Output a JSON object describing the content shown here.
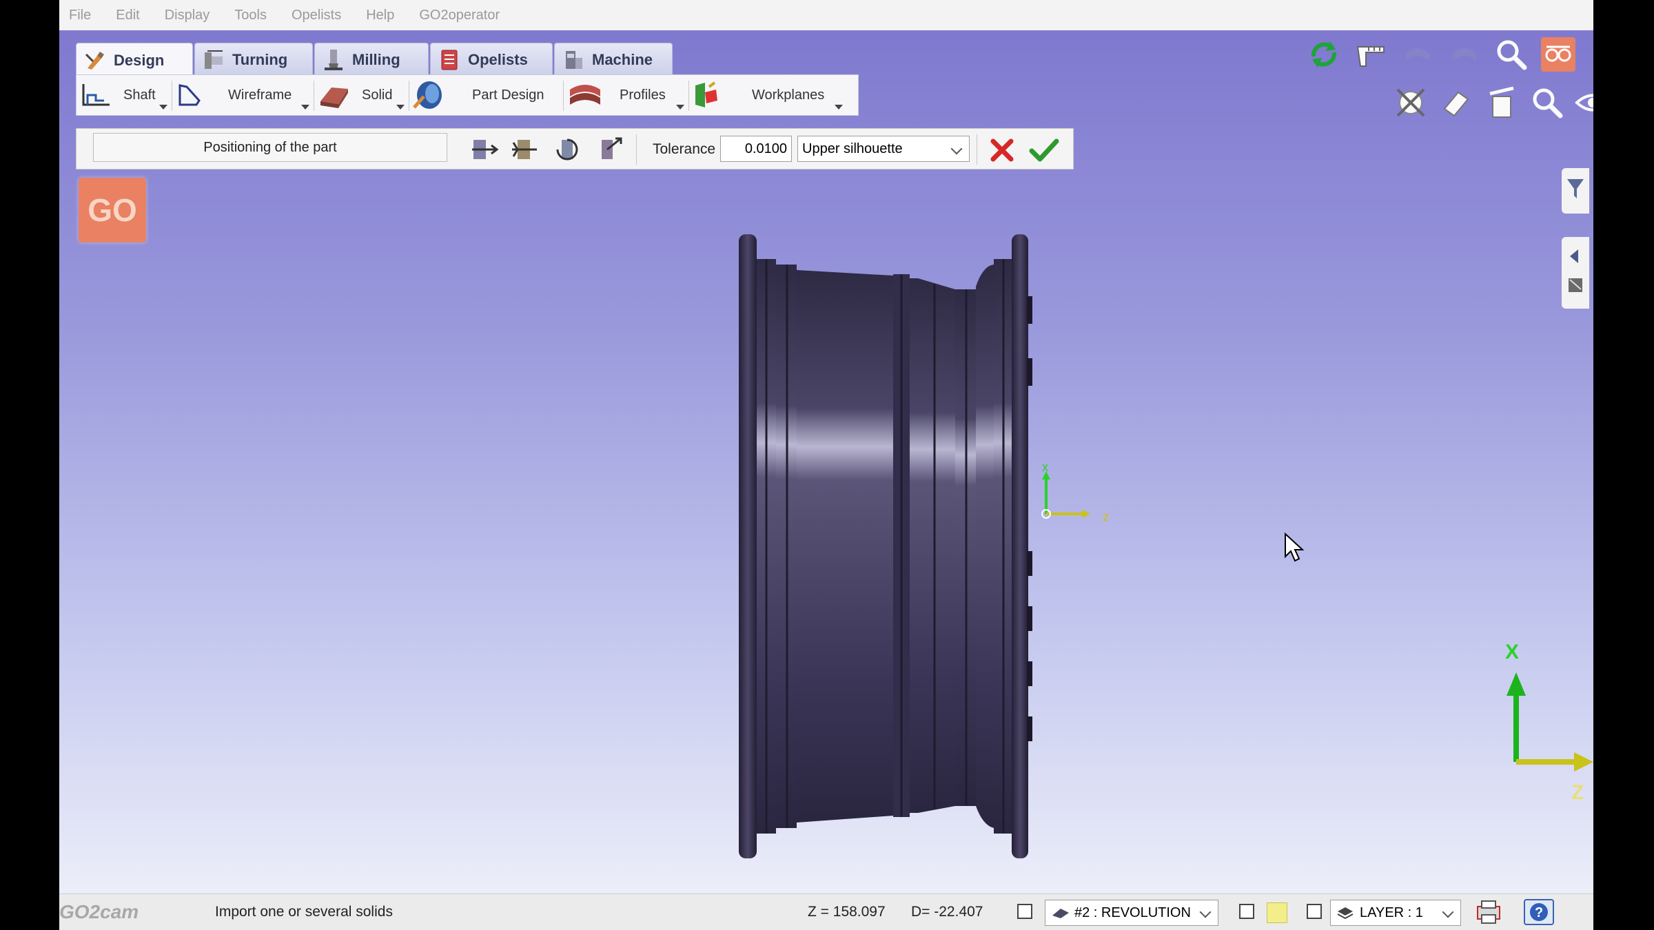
{
  "menu": [
    "File",
    "Edit",
    "Display",
    "Tools",
    "Opelists",
    "Help",
    "GO2operator"
  ],
  "tabs": [
    {
      "label": "Design",
      "icon": "design-icon",
      "active": true
    },
    {
      "label": "Turning",
      "icon": "turning-icon",
      "active": false
    },
    {
      "label": "Milling",
      "icon": "milling-icon",
      "active": false
    },
    {
      "label": "Opelists",
      "icon": "opelists-icon",
      "active": false
    },
    {
      "label": "Machine",
      "icon": "machine-icon",
      "active": false
    }
  ],
  "ribbon": {
    "shaft": "Shaft",
    "wireframe": "Wireframe",
    "solid": "Solid",
    "part_design": "Part Design",
    "profiles": "Profiles",
    "workplanes": "Workplanes"
  },
  "positioning": {
    "status_text": "Positioning of the part",
    "tolerance_label": "Tolerance",
    "tolerance_value": "0.0100",
    "silhouette_selected": "Upper silhouette"
  },
  "logo": "GO",
  "axes": {
    "x": "X",
    "z": "Z",
    "origin_x": "x",
    "origin_z": "z"
  },
  "status": {
    "brand": "GO2cam",
    "hint": "Import one or several solids",
    "z": "Z = 158.097",
    "d": "D= -22.407",
    "revolution": "#2 : REVOLUTION",
    "layer": "LAYER : 1"
  },
  "colors": {
    "accent_orange": "#e98162",
    "axis_green": "#2bd12b",
    "axis_yellow": "#c9c21a",
    "cancel_red": "#d62828",
    "ok_green": "#2e9a2e",
    "part_dark": "#3b3553"
  }
}
